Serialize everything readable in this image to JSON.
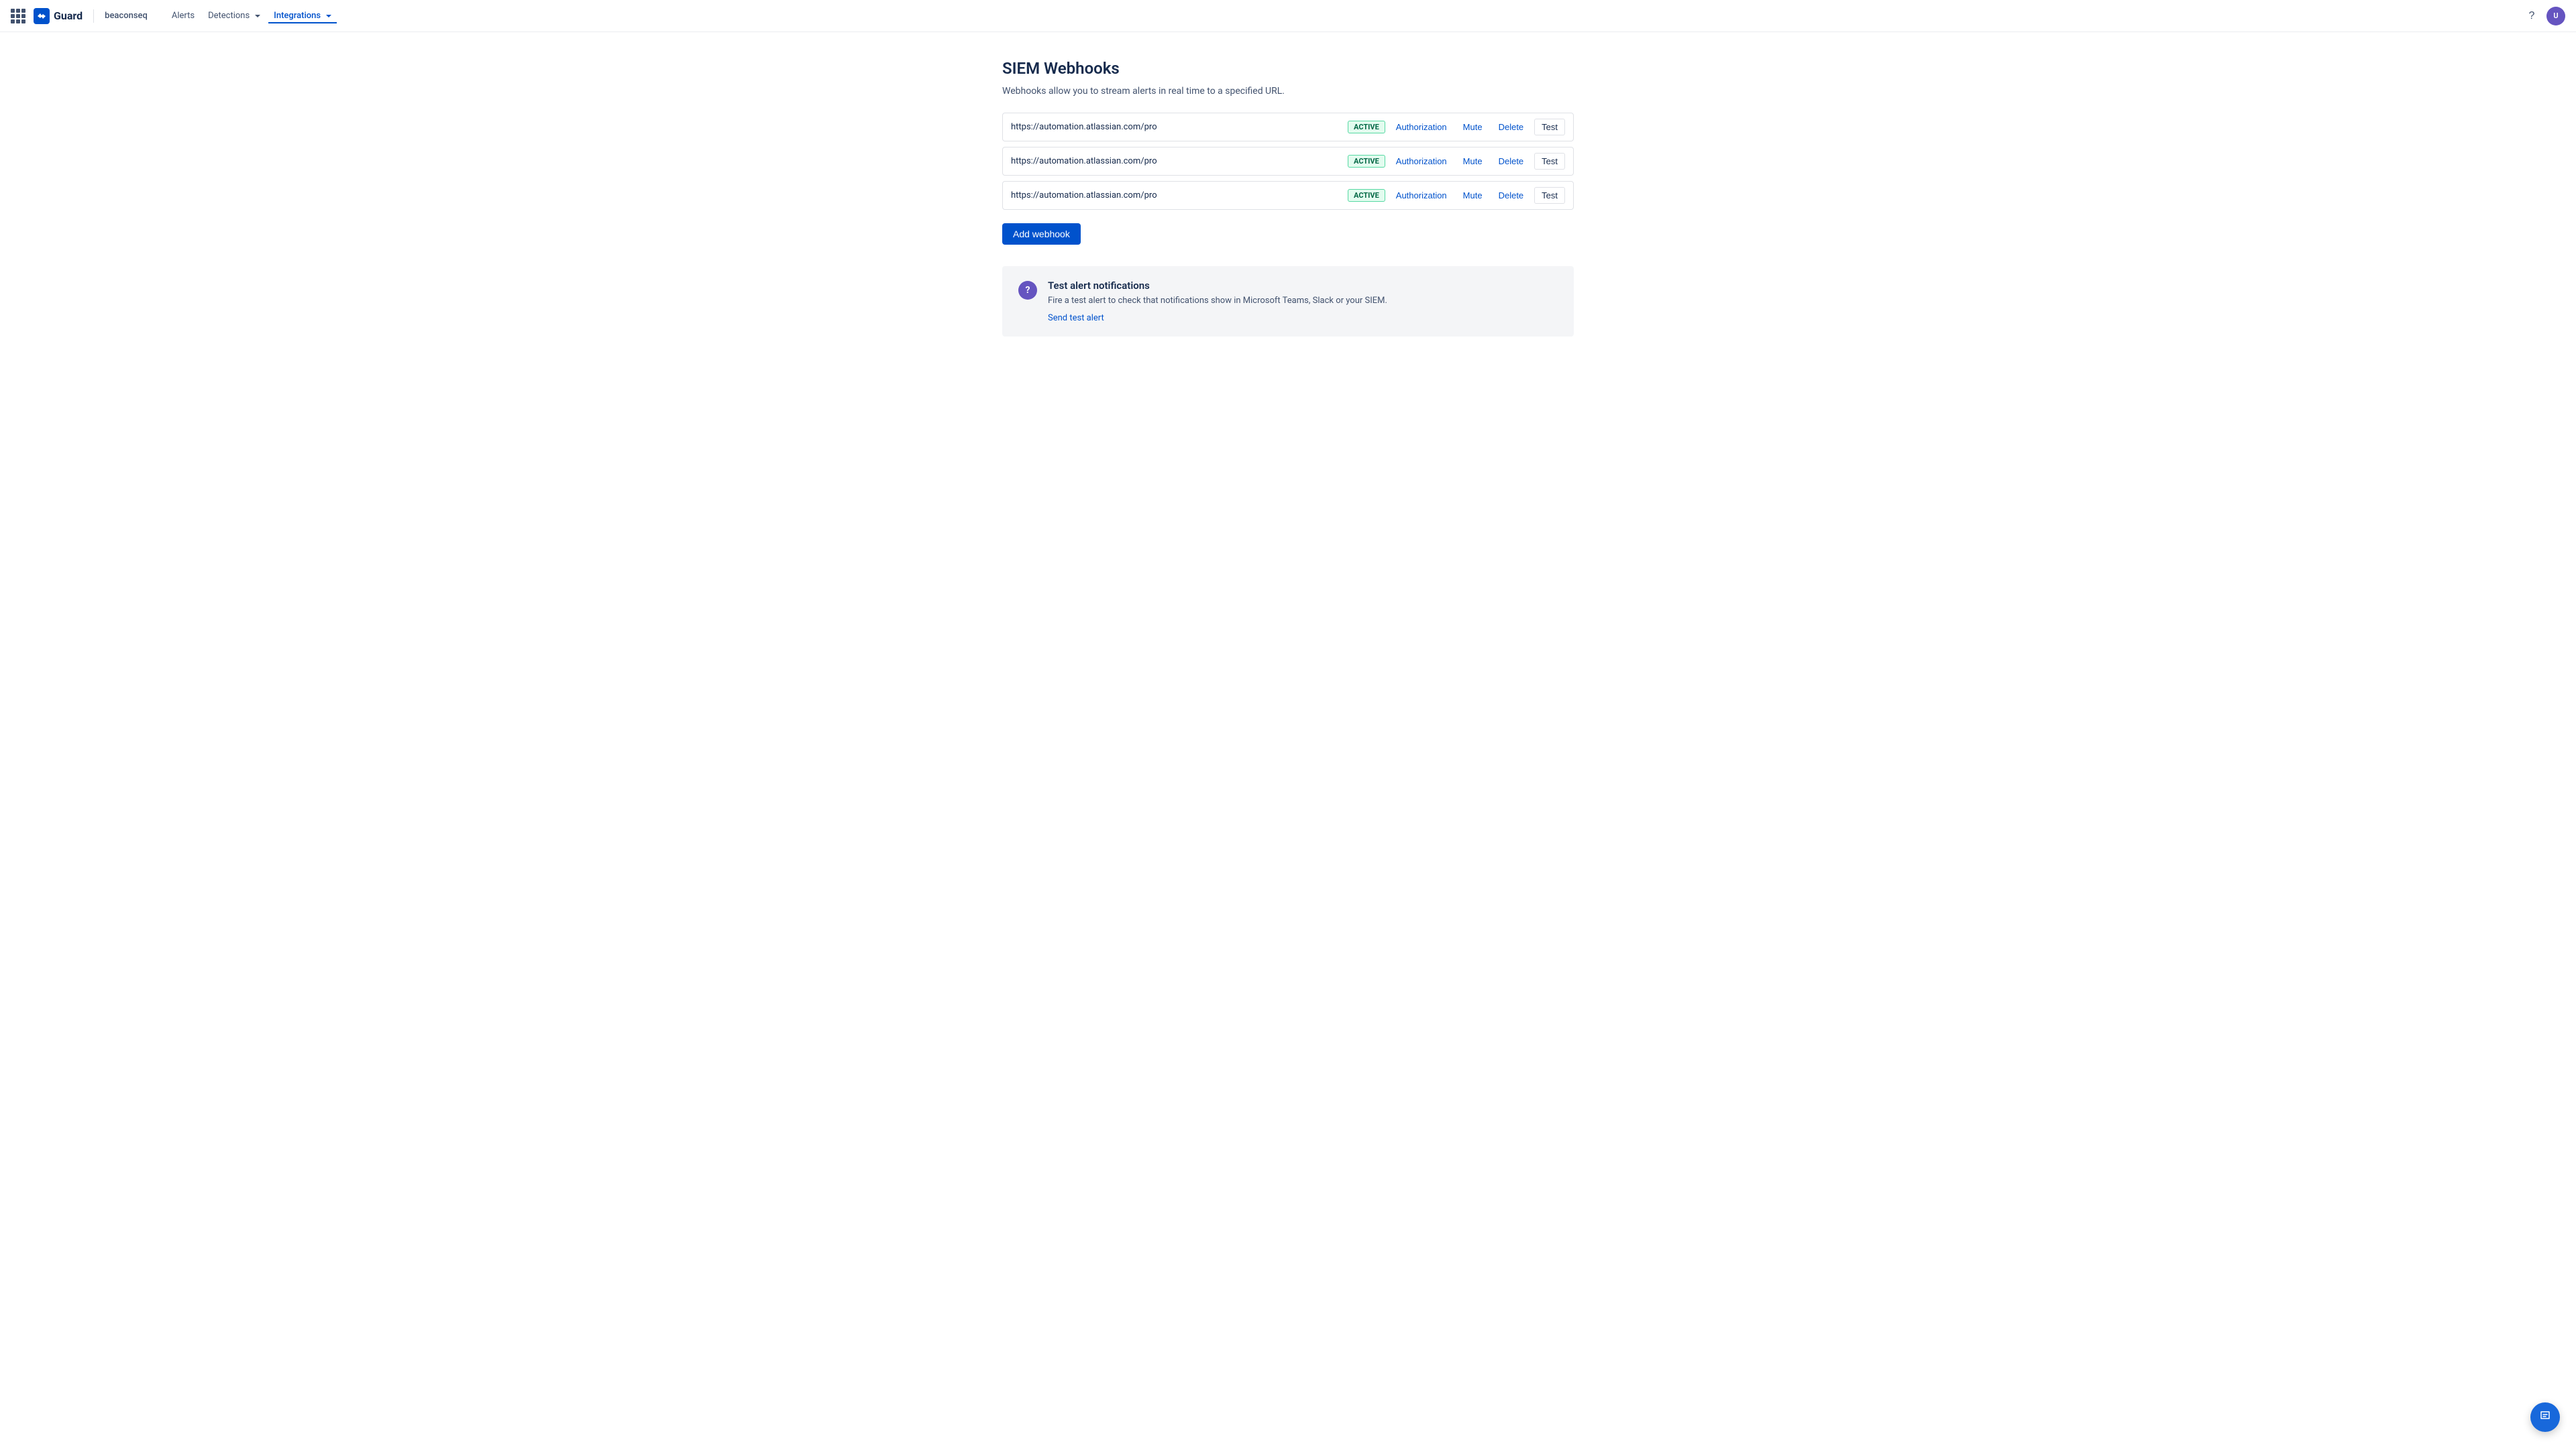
{
  "navbar": {
    "grid_icon_label": "apps-menu",
    "brand_name": "Guard",
    "tenant": "beaconseq",
    "nav_links": [
      {
        "label": "Alerts",
        "active": false
      },
      {
        "label": "Detections",
        "active": false,
        "has_dropdown": true
      },
      {
        "label": "Integrations",
        "active": true,
        "has_dropdown": true
      }
    ]
  },
  "page": {
    "title": "SIEM Webhooks",
    "description": "Webhooks allow you to stream alerts in real time to a specified URL.",
    "webhooks": [
      {
        "url": "https://automation.atlassian.com/pro",
        "status": "ACTIVE",
        "auth_label": "Authorization",
        "mute_label": "Mute",
        "delete_label": "Delete",
        "test_label": "Test"
      },
      {
        "url": "https://automation.atlassian.com/pro",
        "status": "ACTIVE",
        "auth_label": "Authorization",
        "mute_label": "Mute",
        "delete_label": "Delete",
        "test_label": "Test"
      },
      {
        "url": "https://automation.atlassian.com/pro",
        "status": "ACTIVE",
        "auth_label": "Authorization",
        "mute_label": "Mute",
        "delete_label": "Delete",
        "test_label": "Test"
      }
    ],
    "add_webhook_label": "Add webhook",
    "info_card": {
      "title": "Test alert notifications",
      "description": "Fire a test alert to check that notifications show in Microsoft Teams, Slack or your SIEM.",
      "link_label": "Send test alert"
    }
  }
}
